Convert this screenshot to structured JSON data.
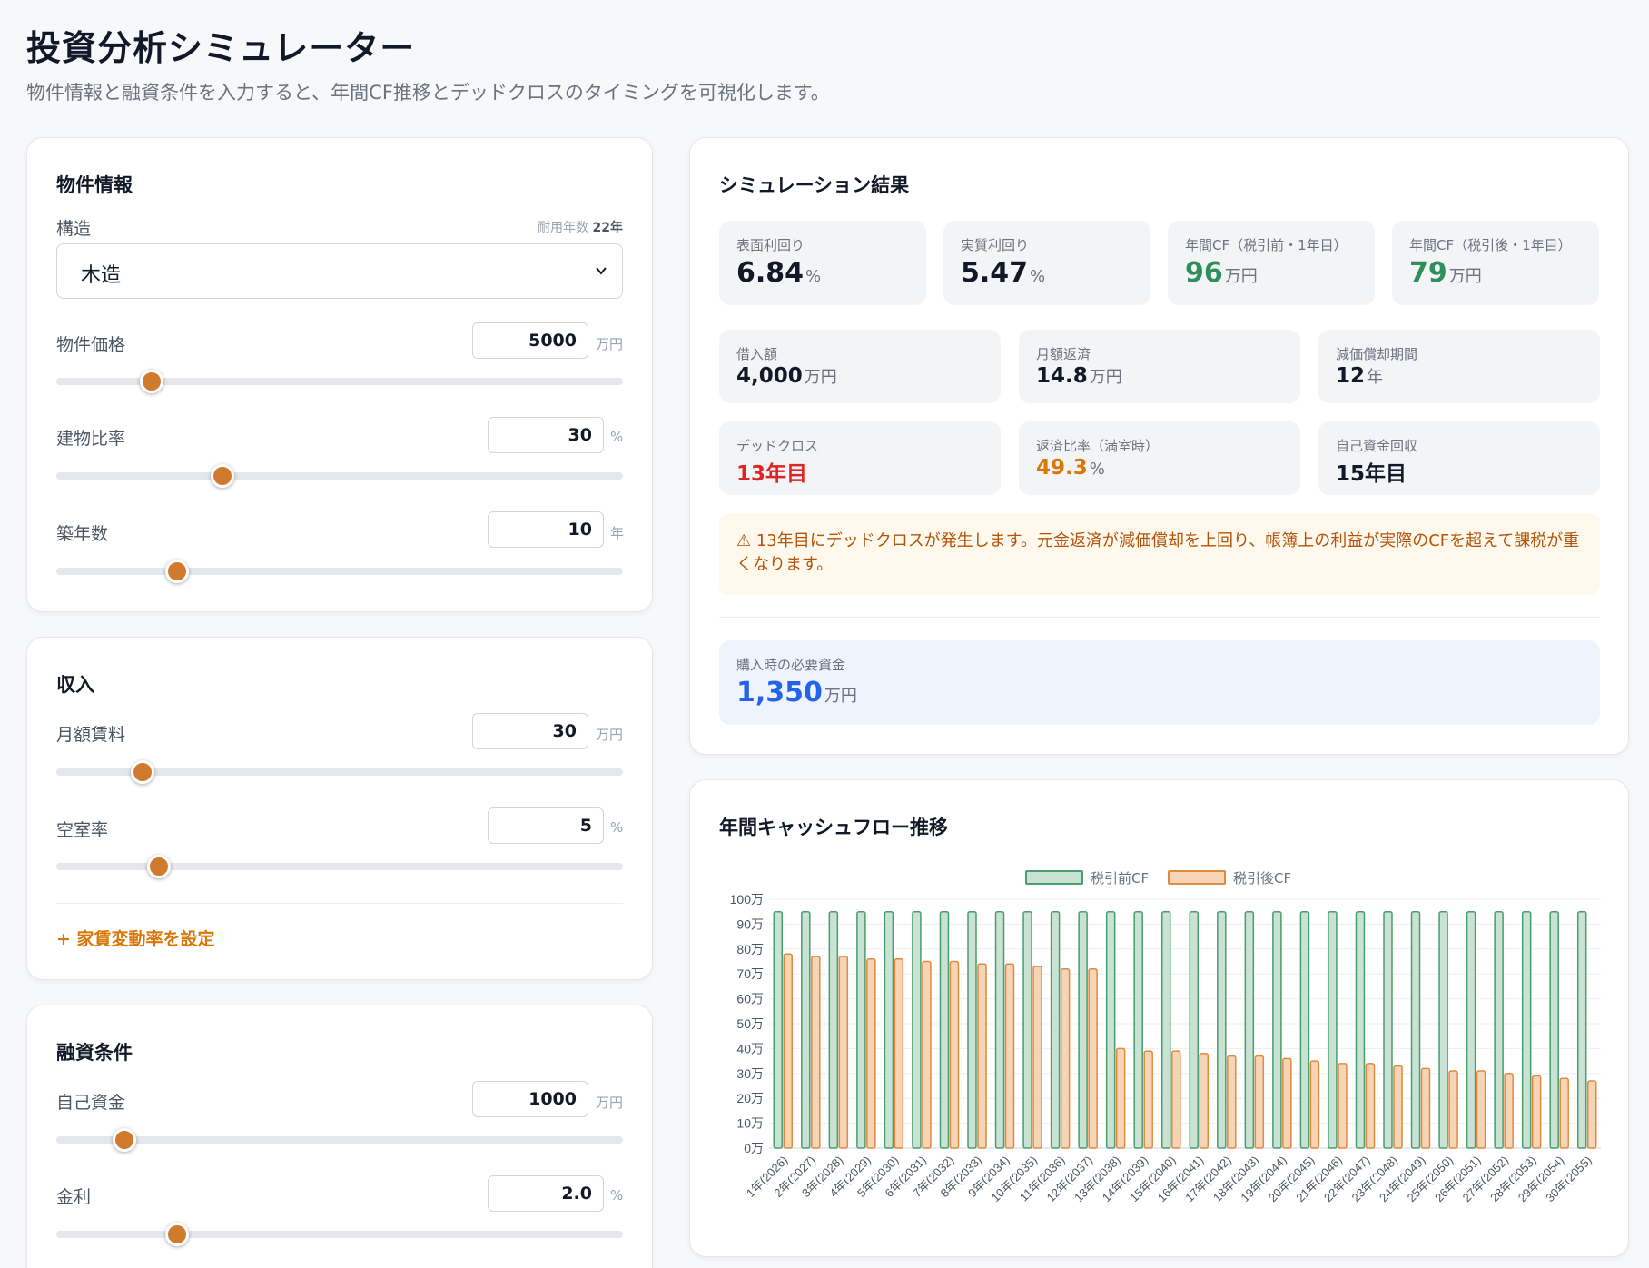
{
  "header": {
    "title": "投資分析シミュレーター",
    "subtitle": "物件情報と融資条件を入力すると、年間CF推移とデッドクロスのタイミングを可視化します。"
  },
  "property": {
    "title": "物件情報",
    "structure_label": "構造",
    "useful_life_label": "耐用年数",
    "useful_life_value": "22年",
    "structure_value": "木造",
    "price": {
      "label": "物件価格",
      "value": "5000",
      "unit": "万円",
      "level": 0.17
    },
    "building_ratio": {
      "label": "建物比率",
      "value": "30",
      "unit": "%",
      "level": 0.3
    },
    "age": {
      "label": "築年数",
      "value": "10",
      "unit": "年",
      "level": 0.22
    }
  },
  "income": {
    "title": "収入",
    "rent": {
      "label": "月額賃料",
      "value": "30",
      "unit": "万円",
      "level": 0.15
    },
    "vacancy": {
      "label": "空室率",
      "value": "5",
      "unit": "%",
      "level": 0.18
    },
    "add_link": "+ 家賃変動率を設定"
  },
  "loan": {
    "title": "融資条件",
    "equity": {
      "label": "自己資金",
      "value": "1000",
      "unit": "万円",
      "level": 0.12
    },
    "interest": {
      "label": "金利",
      "value": "2.0",
      "unit": "%",
      "level": 0.22
    }
  },
  "results": {
    "title": "シミュレーション結果",
    "top": [
      {
        "label": "表面利回り",
        "value": "6.84",
        "unit": "%",
        "color": "#111827"
      },
      {
        "label": "実質利回り",
        "value": "5.47",
        "unit": "%",
        "color": "#111827"
      },
      {
        "label": "年間CF（税引前・1年目）",
        "value": "96",
        "unit": "万円",
        "color": "#2f8f5b"
      },
      {
        "label": "年間CF（税引後・1年目）",
        "value": "79",
        "unit": "万円",
        "color": "#2f8f5b"
      }
    ],
    "mid": [
      {
        "label": "借入額",
        "value": "4,000",
        "unit": "万円",
        "color": "#111827"
      },
      {
        "label": "月額返済",
        "value": "14.8",
        "unit": "万円",
        "color": "#111827"
      },
      {
        "label": "減価償却期間",
        "value": "12",
        "unit": "年",
        "color": "#111827"
      },
      {
        "label": "デッドクロス",
        "value": "13年目",
        "unit": "",
        "color": "#dc2626"
      },
      {
        "label": "返済比率（満室時）",
        "value": "49.3",
        "unit": "%",
        "color": "#d97706"
      },
      {
        "label": "自己資金回収",
        "value": "15年目",
        "unit": "",
        "color": "#111827"
      }
    ],
    "warning": "⚠ 13年目にデッドクロスが発生します。元金返済が減価償却を上回り、帳簿上の利益が実際のCFを超えて課税が重くなります。",
    "required_label": "購入時の必要資金",
    "required_value": "1,350",
    "required_unit": "万円"
  },
  "chart_title": "年間キャッシュフロー推移",
  "colors": {
    "accent": "#d07a2e",
    "pre_tax_fill": "#c8e3d3",
    "pre_tax_stroke": "#4a9d6e",
    "post_tax_fill": "#f6d4b6",
    "post_tax_stroke": "#e08a3e"
  },
  "chart_data": {
    "type": "bar",
    "categories": [
      "1年(2026)",
      "2年(2027)",
      "3年(2028)",
      "4年(2029)",
      "5年(2030)",
      "6年(2031)",
      "7年(2032)",
      "8年(2033)",
      "9年(2034)",
      "10年(2035)",
      "11年(2036)",
      "12年(2037)",
      "13年(2038)",
      "14年(2039)",
      "15年(2040)",
      "16年(2041)",
      "17年(2042)",
      "18年(2043)",
      "19年(2044)",
      "20年(2045)",
      "21年(2046)",
      "22年(2047)",
      "23年(2048)",
      "24年(2049)",
      "25年(2050)",
      "26年(2051)",
      "27年(2052)",
      "28年(2053)",
      "29年(2054)",
      "30年(2055)"
    ],
    "series": [
      {
        "name": "税引前CF",
        "values": [
          95,
          95,
          95,
          95,
          95,
          95,
          95,
          95,
          95,
          95,
          95,
          95,
          95,
          95,
          95,
          95,
          95,
          95,
          95,
          95,
          95,
          95,
          95,
          95,
          95,
          95,
          95,
          95,
          95,
          95
        ]
      },
      {
        "name": "税引後CF",
        "values": [
          78,
          77,
          77,
          76,
          76,
          75,
          75,
          74,
          74,
          73,
          72,
          72,
          40,
          39,
          39,
          38,
          37,
          37,
          36,
          35,
          34,
          34,
          33,
          32,
          31,
          31,
          30,
          29,
          28,
          27
        ]
      }
    ],
    "ylim": [
      0,
      100
    ],
    "yticks": [
      "0万",
      "10万",
      "20万",
      "30万",
      "40万",
      "50万",
      "60万",
      "70万",
      "80万",
      "90万",
      "100万"
    ],
    "legend": "top",
    "grid": true
  }
}
